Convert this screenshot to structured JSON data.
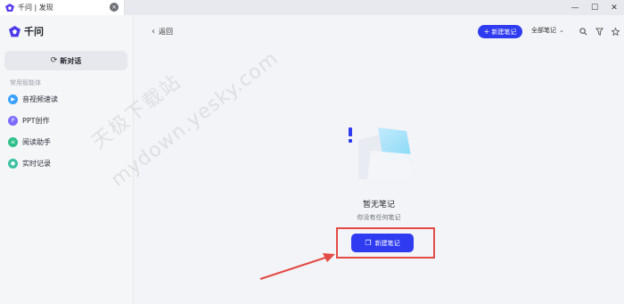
{
  "tab": {
    "title": "千问 | 发现",
    "close": "×"
  },
  "window": {
    "minimize": "—",
    "maximize": "☐",
    "close": "✕"
  },
  "sidebar": {
    "brand": "千问",
    "new_chat": "新对话",
    "section_label": "常用智能体",
    "items": [
      {
        "label": "音视频速读",
        "icon": "video-read-icon",
        "color": "#3aa0ff"
      },
      {
        "label": "PPT创作",
        "icon": "ppt-icon",
        "color": "#7b6cff"
      },
      {
        "label": "阅读助手",
        "icon": "reading-icon",
        "color": "#2fc08a"
      },
      {
        "label": "实时记录",
        "icon": "record-icon",
        "color": "#39c0a0"
      }
    ]
  },
  "header": {
    "back": "返回",
    "new_note": "新建笔记",
    "filter": "全部笔记"
  },
  "empty": {
    "title": "暂无笔记",
    "subtitle": "你没有任何笔记",
    "button": "新建笔记"
  },
  "watermark": {
    "line1": "天极下载站",
    "line2": "mydown.yesky.com"
  },
  "colors": {
    "accent": "#2f3bf0",
    "highlight": "#e24a45"
  }
}
